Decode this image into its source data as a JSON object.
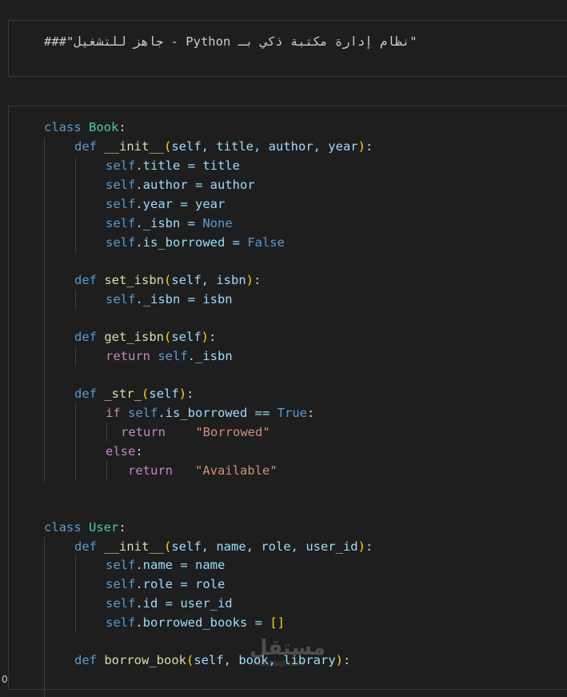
{
  "markdown_cell": {
    "text": "###\"جاهز للتشغيل - Python نظام إدارة مكتبة ذكي بـ\""
  },
  "code": {
    "l1": {
      "kw": "class",
      "name": "Book",
      "p": ":"
    },
    "l2": {
      "kw": "def",
      "name": "__init__",
      "o": "(",
      "args": "self, title, author, year",
      "c": ")",
      "p": ":"
    },
    "l3": {
      "self": "self",
      "rest": ".title = title"
    },
    "l4": {
      "self": "self",
      "rest": ".author = author"
    },
    "l5": {
      "self": "self",
      "rest": ".year = year"
    },
    "l6": {
      "self": "self",
      "rest": "._isbn = ",
      "val": "None"
    },
    "l7": {
      "self": "self",
      "rest": ".is_borrowed = ",
      "val": "False"
    },
    "l8": {
      "kw": "def",
      "name": "set_isbn",
      "o": "(",
      "args": "self, isbn",
      "c": ")",
      "p": ":"
    },
    "l9": {
      "self": "self",
      "rest": "._isbn = isbn"
    },
    "l10": {
      "kw": "def",
      "name": "get_isbn",
      "o": "(",
      "args": "self",
      "c": ")",
      "p": ":"
    },
    "l11": {
      "ret": "return",
      "self": "self",
      "rest": "._isbn"
    },
    "l12": {
      "kw": "def",
      "name": "_str_",
      "o": "(",
      "args": "self",
      "c": ")",
      "p": ":"
    },
    "l13": {
      "if": "if",
      "self": "self",
      "rest": ".is_borrowed == ",
      "val": "True",
      "p": ":"
    },
    "l14": {
      "ret": "return",
      "str": "\"Borrowed\""
    },
    "l15": {
      "else": "else",
      "p": ":"
    },
    "l16": {
      "ret": "return",
      "str": "\"Available\""
    },
    "l17": {
      "kw": "class",
      "name": "User",
      "p": ":"
    },
    "l18": {
      "kw": "def",
      "name": "__init__",
      "o": "(",
      "args": "self, name, role, user_id",
      "c": ")",
      "p": ":"
    },
    "l19": {
      "self": "self",
      "rest": ".name = name"
    },
    "l20": {
      "self": "self",
      "rest": ".role = role"
    },
    "l21": {
      "self": "self",
      "rest": ".id = user_id"
    },
    "l22": {
      "self": "self",
      "rest": ".borrowed_books = ",
      "br": "[]"
    },
    "l23": {
      "kw": "def",
      "name": "borrow_book",
      "o": "(",
      "args": "self, book, library",
      "c": ")",
      "p": ":"
    }
  },
  "watermark": {
    "arabic": "مستقل",
    "latin": "mostaql.com"
  },
  "corner_text": "0"
}
